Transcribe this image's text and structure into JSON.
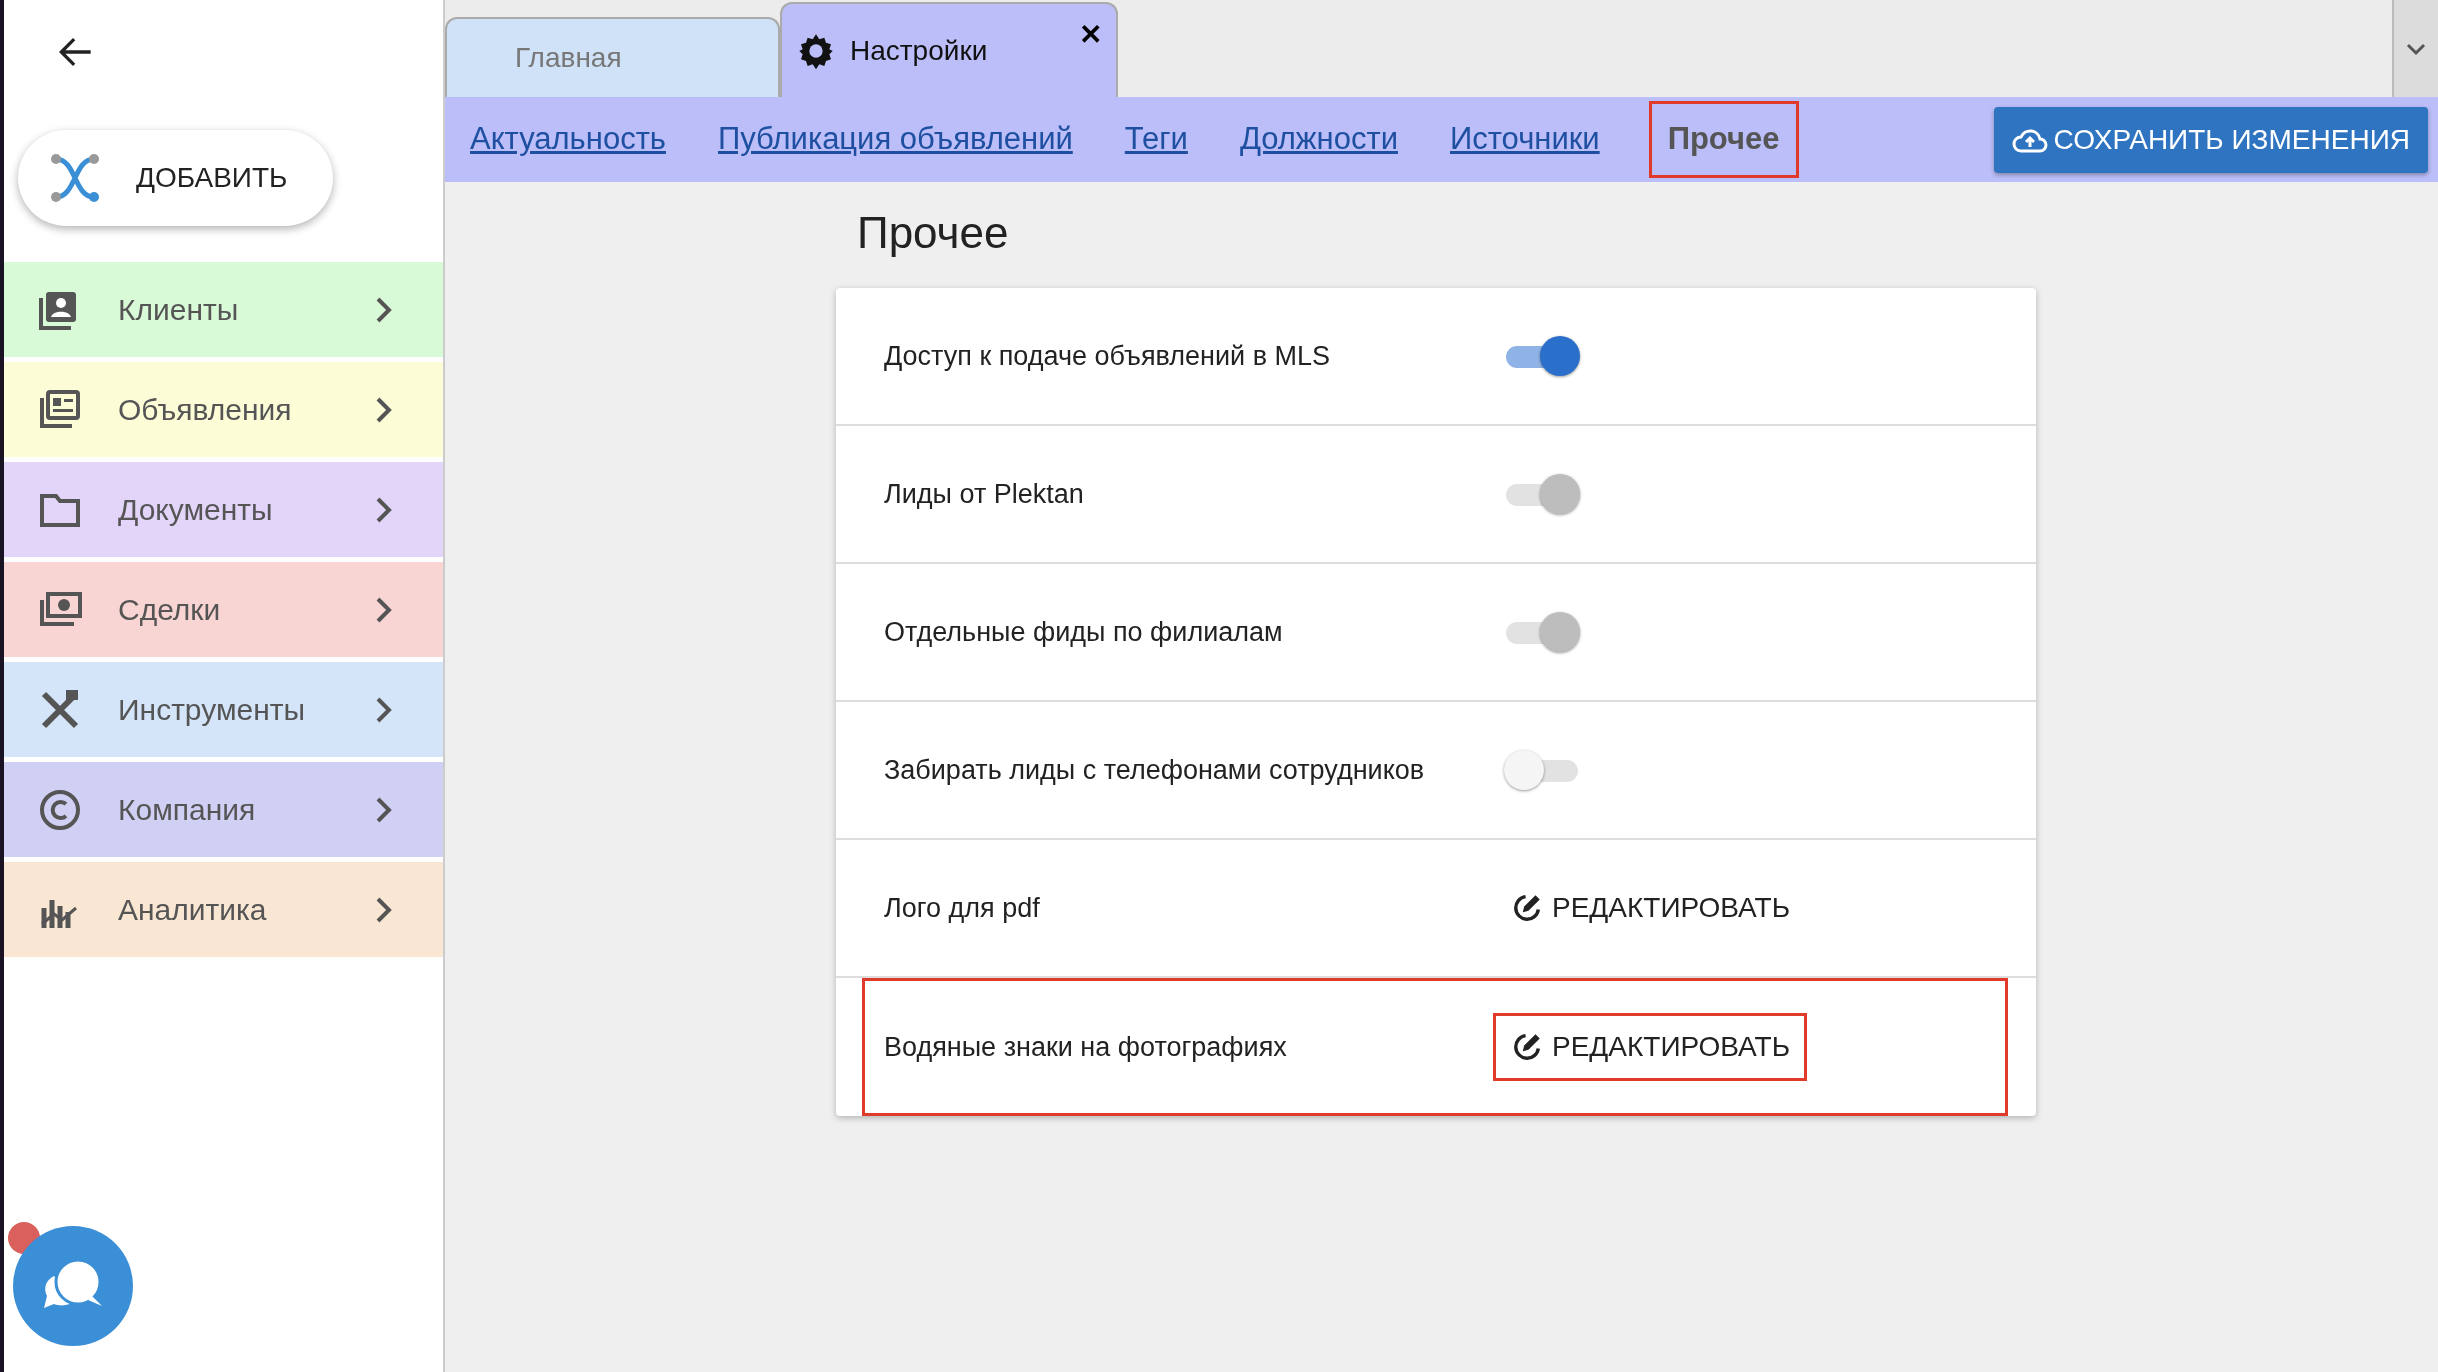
{
  "sidebar": {
    "add_button": "ДОБАВИТЬ",
    "items": [
      {
        "label": "Клиенты",
        "color": "#d9fad6"
      },
      {
        "label": "Объявления",
        "color": "#fcfcd7"
      },
      {
        "label": "Документы",
        "color": "#e3d4fa"
      },
      {
        "label": "Сделки",
        "color": "#f8d4d3"
      },
      {
        "label": "Инструменты",
        "color": "#d4e5fa"
      },
      {
        "label": "Компания",
        "color": "#d0d0f5"
      },
      {
        "label": "Аналитика",
        "color": "#f9e6d3"
      }
    ]
  },
  "tabs": [
    {
      "label": "Главная",
      "selected": false
    },
    {
      "label": "Настройки",
      "selected": true,
      "close": "✕"
    }
  ],
  "subnav": [
    {
      "label": "Актуальность",
      "selected": false
    },
    {
      "label": "Публикация объявлений",
      "selected": false
    },
    {
      "label": "Теги",
      "selected": false
    },
    {
      "label": "Должности",
      "selected": false
    },
    {
      "label": "Источники",
      "selected": false
    },
    {
      "label": "Прочее",
      "selected": true
    }
  ],
  "save_button": "СОХРАНИТЬ ИЗМЕНЕНИЯ",
  "page_title": "Прочее",
  "settings": [
    {
      "kind": "toggle",
      "label": "Доступ к подаче объявлений в MLS",
      "on": true,
      "disabled": false,
      "highlighted": false
    },
    {
      "kind": "toggle",
      "label": "Лиды от Plektan",
      "on": true,
      "disabled": true,
      "highlighted": false
    },
    {
      "kind": "toggle",
      "label": "Отдельные фиды по филиалам",
      "on": true,
      "disabled": true,
      "highlighted": false
    },
    {
      "kind": "toggle",
      "label": "Забирать лиды с телефонами сотрудников",
      "on": false,
      "disabled": false,
      "highlighted": false
    },
    {
      "kind": "edit",
      "label": "Лого для pdf",
      "action": "РЕДАКТИРОВАТЬ",
      "highlighted": false
    },
    {
      "kind": "edit",
      "label": "Водяные знаки на фотографиях",
      "action": "РЕДАКТИРОВАТЬ",
      "highlighted": true
    }
  ]
}
